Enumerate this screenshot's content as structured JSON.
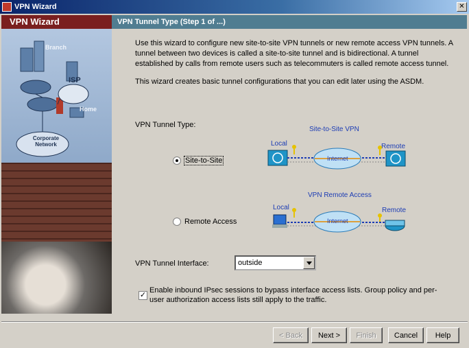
{
  "window": {
    "title": "VPN Wizard",
    "close_glyph": "✕"
  },
  "sidebar": {
    "title": "VPN Wizard",
    "art_labels": {
      "branch": "Branch",
      "isp": "ISP",
      "home": "Home",
      "corporate": "Corporate Network"
    }
  },
  "header": {
    "title": "VPN Tunnel Type   (Step 1 of ...)"
  },
  "intro": {
    "para1": "Use this wizard to configure new site-to-site VPN tunnels or new remote access VPN tunnels. A tunnel between two devices is called a site-to-site tunnel and is bidirectional. A tunnel established by calls from remote users such as telecommuters is called remote access tunnel.",
    "para2": "This wizard creates basic tunnel configurations that you can edit later using the ASDM."
  },
  "tunnel_type": {
    "label": "VPN Tunnel Type:",
    "options": [
      {
        "label": "Site-to-Site",
        "selected": true
      },
      {
        "label": "Remote Access",
        "selected": false
      }
    ]
  },
  "diagrams": {
    "site_to_site": {
      "title": "Site-to-Site VPN",
      "local": "Local",
      "internet": "Internet",
      "remote": "Remote"
    },
    "remote_access": {
      "title": "VPN Remote Access",
      "local": "Local",
      "internet": "Internet",
      "remote": "Remote"
    }
  },
  "interface": {
    "label": "VPN Tunnel Interface:",
    "value": "outside"
  },
  "bypass": {
    "checked": true,
    "check_glyph": "✓",
    "text": "Enable inbound IPsec sessions to bypass interface access lists. Group policy and per-user authorization access lists still apply to the traffic."
  },
  "buttons": {
    "back": "< Back",
    "next": "Next >",
    "finish": "Finish",
    "cancel": "Cancel",
    "help": "Help"
  },
  "colors": {
    "header_bg": "#507d91",
    "sidebar_header_bg": "#7a1f1f",
    "diagram_text": "#1c3cb4"
  }
}
